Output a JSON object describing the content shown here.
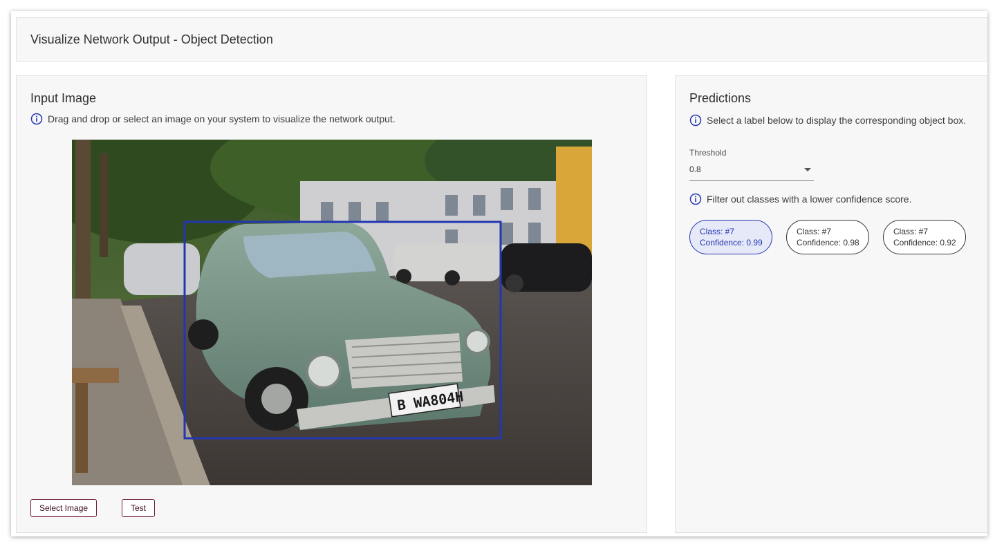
{
  "header": {
    "title": "Visualize Network Output - Object Detection"
  },
  "input_panel": {
    "title": "Input Image",
    "info_text": "Drag and drop or select an image on your system to visualize the network output.",
    "image_description": "",
    "select_button": "Select Image",
    "test_button": "Test"
  },
  "predictions_panel": {
    "title": "Predictions",
    "info_text": "Select a label below to display the corresponding object box.",
    "threshold": {
      "label": "Threshold",
      "value": "0.8"
    },
    "filter_info": "Filter out classes with a lower confidence score.",
    "chips": [
      {
        "class_text": "Class: #7",
        "confidence_text": "Confidence: 0.99",
        "selected": true
      },
      {
        "class_text": "Class: #7",
        "confidence_text": "Confidence: 0.98",
        "selected": false
      },
      {
        "class_text": "Class: #7",
        "confidence_text": "Confidence: 0.92",
        "selected": false
      }
    ]
  },
  "colors": {
    "accent_blue": "#2336b0",
    "button_border": "#6b1d3c",
    "selected_chip_bg": "#e6e9f8",
    "panel_bg": "#f7f7f7"
  },
  "icons": {
    "info": "info-circle-icon",
    "dropdown": "caret-down-icon"
  }
}
